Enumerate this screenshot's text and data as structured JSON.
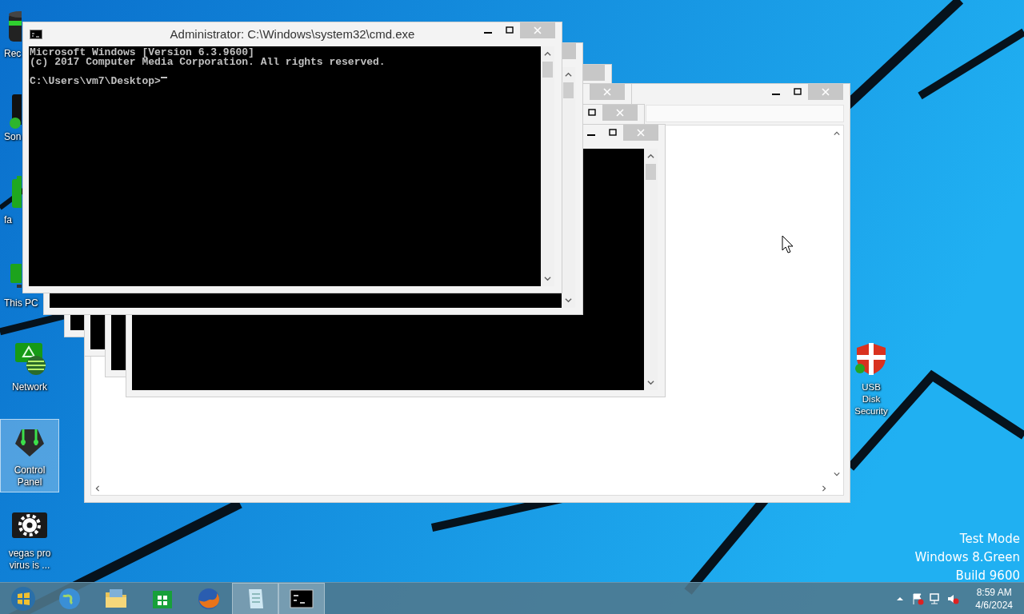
{
  "desktop_icons": [
    {
      "label": "Rec",
      "kind": "partial",
      "selected": false
    },
    {
      "label": "Son",
      "kind": "partial",
      "selected": false
    },
    {
      "label": "fa",
      "kind": "partial",
      "selected": false
    },
    {
      "label": "This PC",
      "kind": "partial",
      "selected": false
    },
    {
      "label": "Network",
      "kind": "full",
      "selected": false
    },
    {
      "label": "Control Panel",
      "kind": "full",
      "selected": true
    },
    {
      "label": "vegas pro virus is ...",
      "kind": "full",
      "selected": false
    },
    {
      "label": "USB Disk Security",
      "kind": "full",
      "selected": false
    }
  ],
  "windows": [
    {
      "kind": "explorer"
    },
    {
      "kind": "console"
    },
    {
      "kind": "console"
    },
    {
      "kind": "console"
    },
    {
      "kind": "console"
    },
    {
      "kind": "console"
    },
    {
      "kind": "console",
      "title": "Administrator: C:\\Windows\\system32\\cmd.exe",
      "lines": [
        "Microsoft Windows [Version 6.3.9600]",
        "(c) 2017 Computer Media Corporation. All rights reserved."
      ],
      "prompt": "C:\\Users\\vm7\\Desktop>"
    }
  ],
  "watermark_lines": [
    "Test Mode",
    "Windows 8.Green",
    "Build 9600"
  ],
  "taskbar": {
    "buttons": [
      {
        "running": false
      },
      {
        "running": false
      },
      {
        "running": false
      },
      {
        "running": false
      },
      {
        "running": false
      },
      {
        "running": true
      },
      {
        "running": true
      }
    ],
    "clock": {
      "time": "8:59 AM",
      "date": "4/6/2024"
    }
  }
}
